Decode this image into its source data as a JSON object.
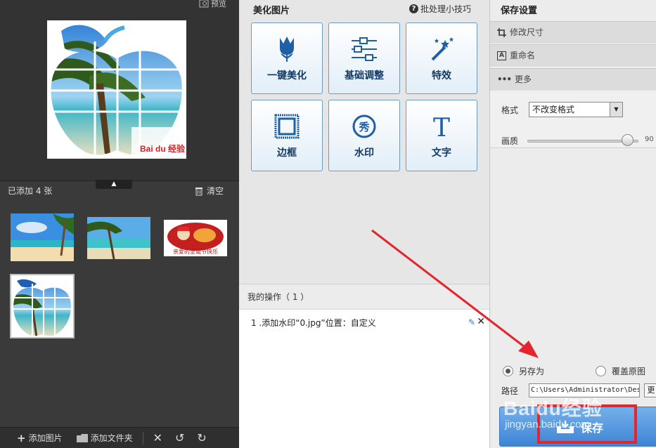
{
  "left": {
    "preview_label": "预览",
    "added_count": "已添加 4 张",
    "clear_label": "清空",
    "preview_badge": "Bai du 经验",
    "thumb3_caption": "亲爱的圣诞节快乐",
    "toolbar": {
      "add_image": "添加图片",
      "add_folder": "添加文件夹"
    }
  },
  "middle": {
    "title": "美化图片",
    "tips": "批处理小技巧",
    "tiles": [
      {
        "label": "一键美化",
        "icon": "tulip-icon"
      },
      {
        "label": "基础调整",
        "icon": "sliders-icon"
      },
      {
        "label": "特效",
        "icon": "magic-wand-icon"
      },
      {
        "label": "边框",
        "icon": "frame-icon"
      },
      {
        "label": "水印",
        "icon": "watermark-stamp-icon"
      },
      {
        "label": "文字",
        "icon": "text-t-icon"
      }
    ],
    "ops_header": "我的操作（ 1 ）",
    "ops_item": "1 .添加水印“0.jpg”位置：自定义"
  },
  "right": {
    "title": "保存设置",
    "resize": "修改尺寸",
    "rename": "重命名",
    "more": "更多",
    "format_label": "格式",
    "format_value": "不改变格式",
    "quality_label": "画质",
    "quality_value": "90",
    "quality_percent": 90,
    "save_as": "另存为",
    "overwrite": "覆盖原图",
    "path_label": "路径",
    "path_value": "C:\\Users\\Administrator\\Desktop",
    "browse": "更",
    "save_button": "保存"
  },
  "watermark": {
    "logo": "Baidu经验",
    "url": "jingyan.baidu.com"
  },
  "colors": {
    "left_bg": "#3a3a3a",
    "tile_border": "#6f9bc1",
    "save_button": "#4a8ddb",
    "annotation": "#e3262e"
  }
}
